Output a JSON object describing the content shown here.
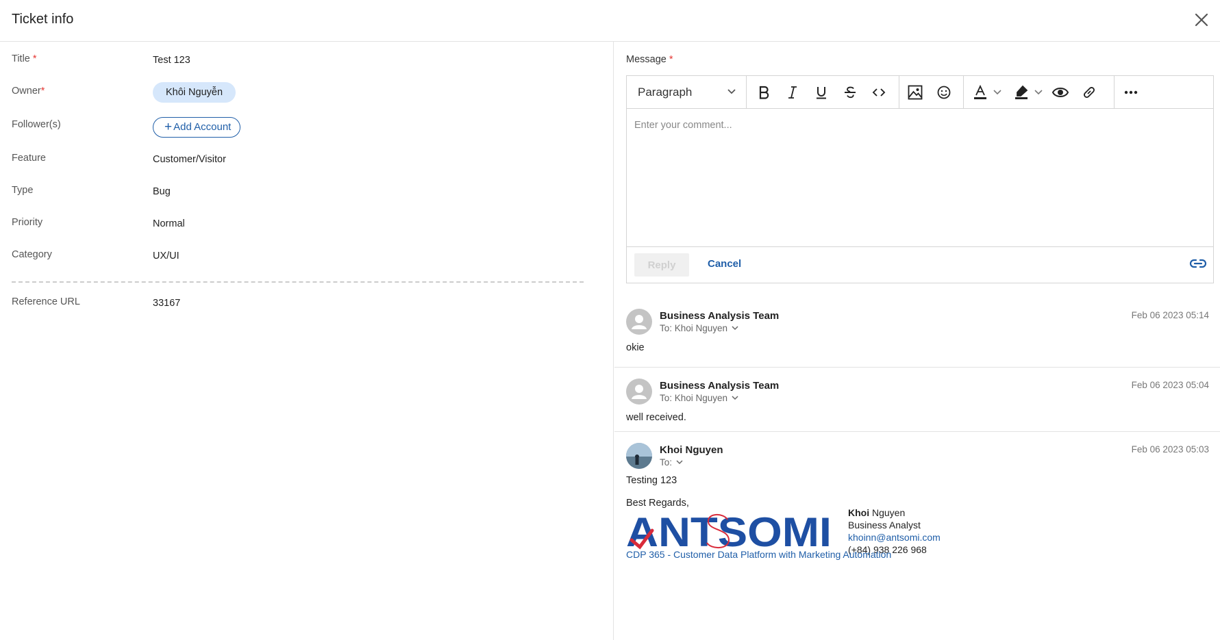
{
  "header": {
    "title": "Ticket info"
  },
  "fields": {
    "title": {
      "label": "Title",
      "required": "*",
      "value": "Test 123"
    },
    "owner": {
      "label": "Owner",
      "required": "*",
      "chip": "Khôi Nguyễn"
    },
    "followers": {
      "label": "Follower(s)",
      "button": "Add Account"
    },
    "feature": {
      "label": "Feature",
      "value": "Customer/Visitor"
    },
    "type": {
      "label": "Type",
      "value": "Bug"
    },
    "priority": {
      "label": "Priority",
      "value": "Normal"
    },
    "category": {
      "label": "Category",
      "value": "UX/UI"
    },
    "reference": {
      "label": "Reference URL",
      "value": "33167"
    }
  },
  "editor": {
    "label": "Message",
    "required": "*",
    "block_format": "Paragraph",
    "placeholder": "Enter your comment...",
    "reply_label": "Reply",
    "cancel_label": "Cancel",
    "toolbar_icons": [
      "bold-icon",
      "italic-icon",
      "underline-icon",
      "strikethrough-icon",
      "code-icon",
      "image-icon",
      "emoji-icon",
      "text-color-icon",
      "highlight-icon",
      "preview-icon",
      "link-icon",
      "more-icon"
    ]
  },
  "messages": [
    {
      "sender": "Business Analysis Team",
      "to": "To: Khoi Nguyen",
      "time": "Feb 06 2023 05:14",
      "body": "okie"
    },
    {
      "sender": "Business Analysis Team",
      "to": "To: Khoi Nguyen",
      "time": "Feb 06 2023 05:04",
      "body": "well received."
    },
    {
      "sender": "Khoi Nguyen",
      "to": "To:",
      "time": "Feb 06 2023 05:03",
      "body": "Testing 123",
      "regards": "Best Regards,",
      "signature": {
        "logo": "ANTSOMI",
        "first_name": "Khoi",
        "last_name": "Nguyen",
        "role": "Business Analyst",
        "email": "khoinn@antsomi.com",
        "phone": "(+84) 938 226 968",
        "tagline": "CDP 365 - Customer Data Platform with Marketing Automation"
      }
    }
  ],
  "colors": {
    "accent": "#1f5ea8",
    "required": "#e53935",
    "chip": "#d6e7fb",
    "logo_blue": "#1e4fa3",
    "logo_red": "#d92b3a"
  }
}
